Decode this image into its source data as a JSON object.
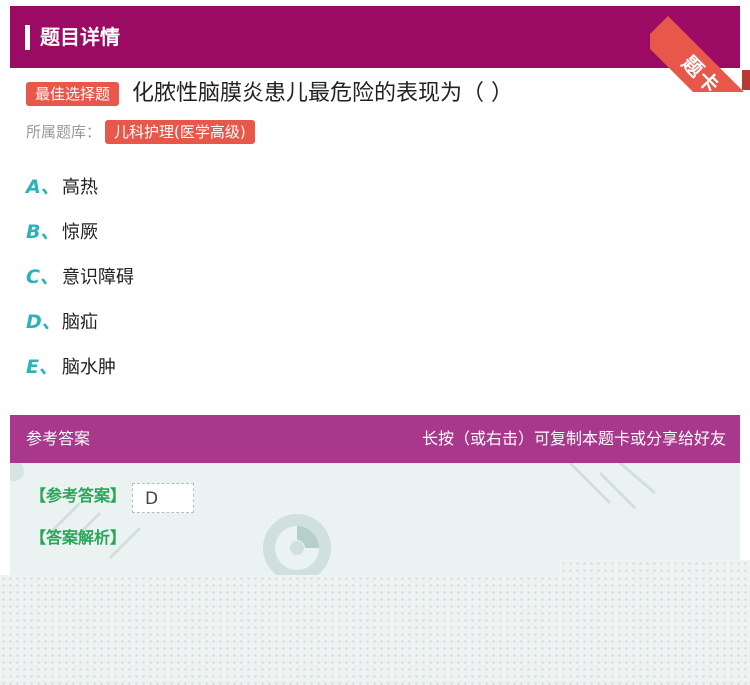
{
  "header": {
    "title": "题目详情"
  },
  "ribbon": {
    "label": "题卡"
  },
  "question": {
    "type_badge": "最佳选择题",
    "text": "化脓性脑膜炎患儿最危险的表现为（ ）",
    "library_label": "所属题库：",
    "library_name": "儿科护理(医学高级)"
  },
  "options": [
    {
      "letter": "A、",
      "text": "高热"
    },
    {
      "letter": "B、",
      "text": "惊厥"
    },
    {
      "letter": "C、",
      "text": "意识障碍"
    },
    {
      "letter": "D、",
      "text": "脑疝"
    },
    {
      "letter": "E、",
      "text": "脑水肿"
    }
  ],
  "answer_bar": {
    "left_label": "参考答案",
    "right_hint": "长按（或右击）可复制本题卡或分享给好友"
  },
  "answer": {
    "reference_label": "【参考答案】",
    "reference_value": "D",
    "analysis_label": "【答案解析】"
  },
  "colors": {
    "header_bg": "#9b0a63",
    "badge_bg": "#e8584a",
    "option_letter": "#2ab3b8",
    "answer_bar_bg": "#a8388c",
    "answer_label": "#2aa65a",
    "answer_body_bg": "#eaf3f2"
  },
  "icons": {
    "watermark": "spiral-logo-icon",
    "ribbon": "corner-ribbon"
  }
}
